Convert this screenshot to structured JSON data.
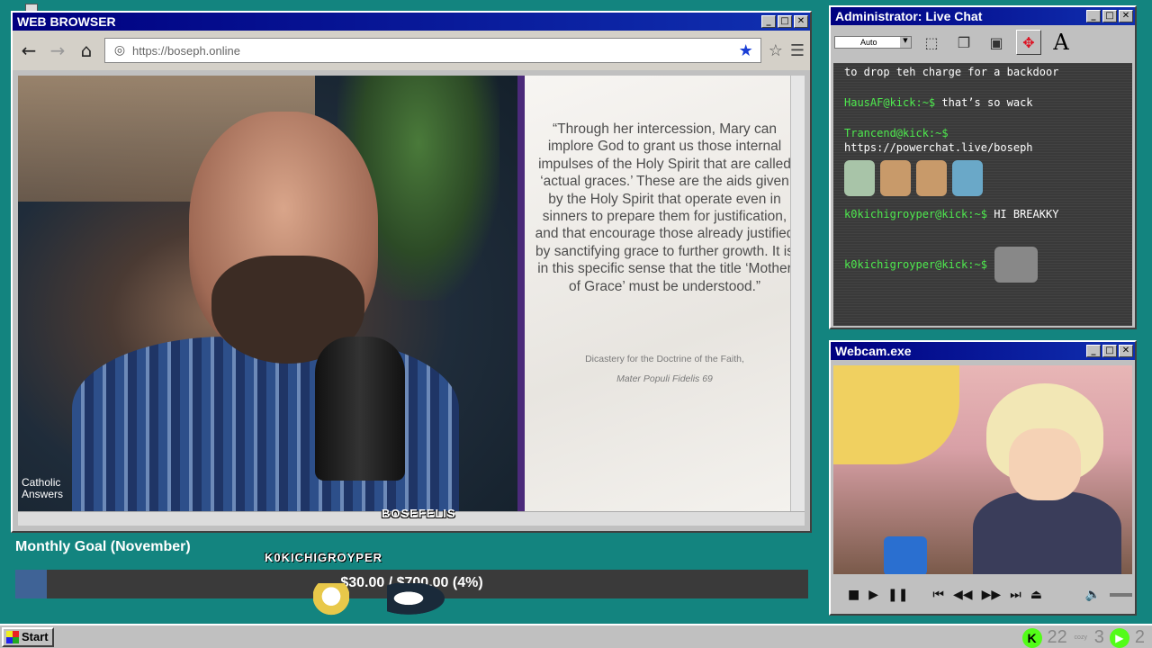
{
  "browser": {
    "title": "WEB BROWSER",
    "url": "https://boseph.online",
    "video": {
      "quote": "“Through her intercession, Mary can implore God to grant us those internal impulses of the Holy Spirit that are called ‘actual graces.’ These are the aids given by the Holy Spirit that operate even in sinners to prepare them for justification, and that encourage those already justified by sanctifying grace to further growth. It is in this specific sense that the title ‘Mother of Grace’ must be understood.”",
      "cite_line1": "Dicastery for the Doctrine of the Faith,",
      "cite_line2": "Mater Populi Fidelis 69",
      "logo": "Catholic Answers",
      "caption": "BOSEFELIS"
    }
  },
  "chat": {
    "title": "Administrator: Live Chat",
    "font_select": "Auto",
    "messages": [
      {
        "user": "",
        "text": "to drop teh charge for a backdoor"
      },
      {
        "user": "HausAF@kick:~$",
        "text": "that’s so wack"
      },
      {
        "user": "Trancend@kick:~$",
        "text": "https://powerchat.live/boseph"
      },
      {
        "user": "k0kichigroyper@kick:~$",
        "text": "HI BREAKKY"
      },
      {
        "user": "k0kichigroyper@kick:~$",
        "text": ""
      }
    ]
  },
  "webcam": {
    "title": "Webcam.exe"
  },
  "goal": {
    "title": "Monthly Goal (November)",
    "text": "$30.00 / $700.00 (4%)",
    "progress": 0.04,
    "user_tag": "K0KICHIGROYPER"
  },
  "taskbar": {
    "start_label": "Start",
    "tray_count_1": "22",
    "tray_cozy": "cozy",
    "tray_count_2": "3",
    "tray_count_3": "2"
  },
  "colors": {
    "desktop": "#13847f",
    "titlebar": "#000080",
    "chat_user": "#4eea4e",
    "goal_fill": "#3f6396"
  }
}
